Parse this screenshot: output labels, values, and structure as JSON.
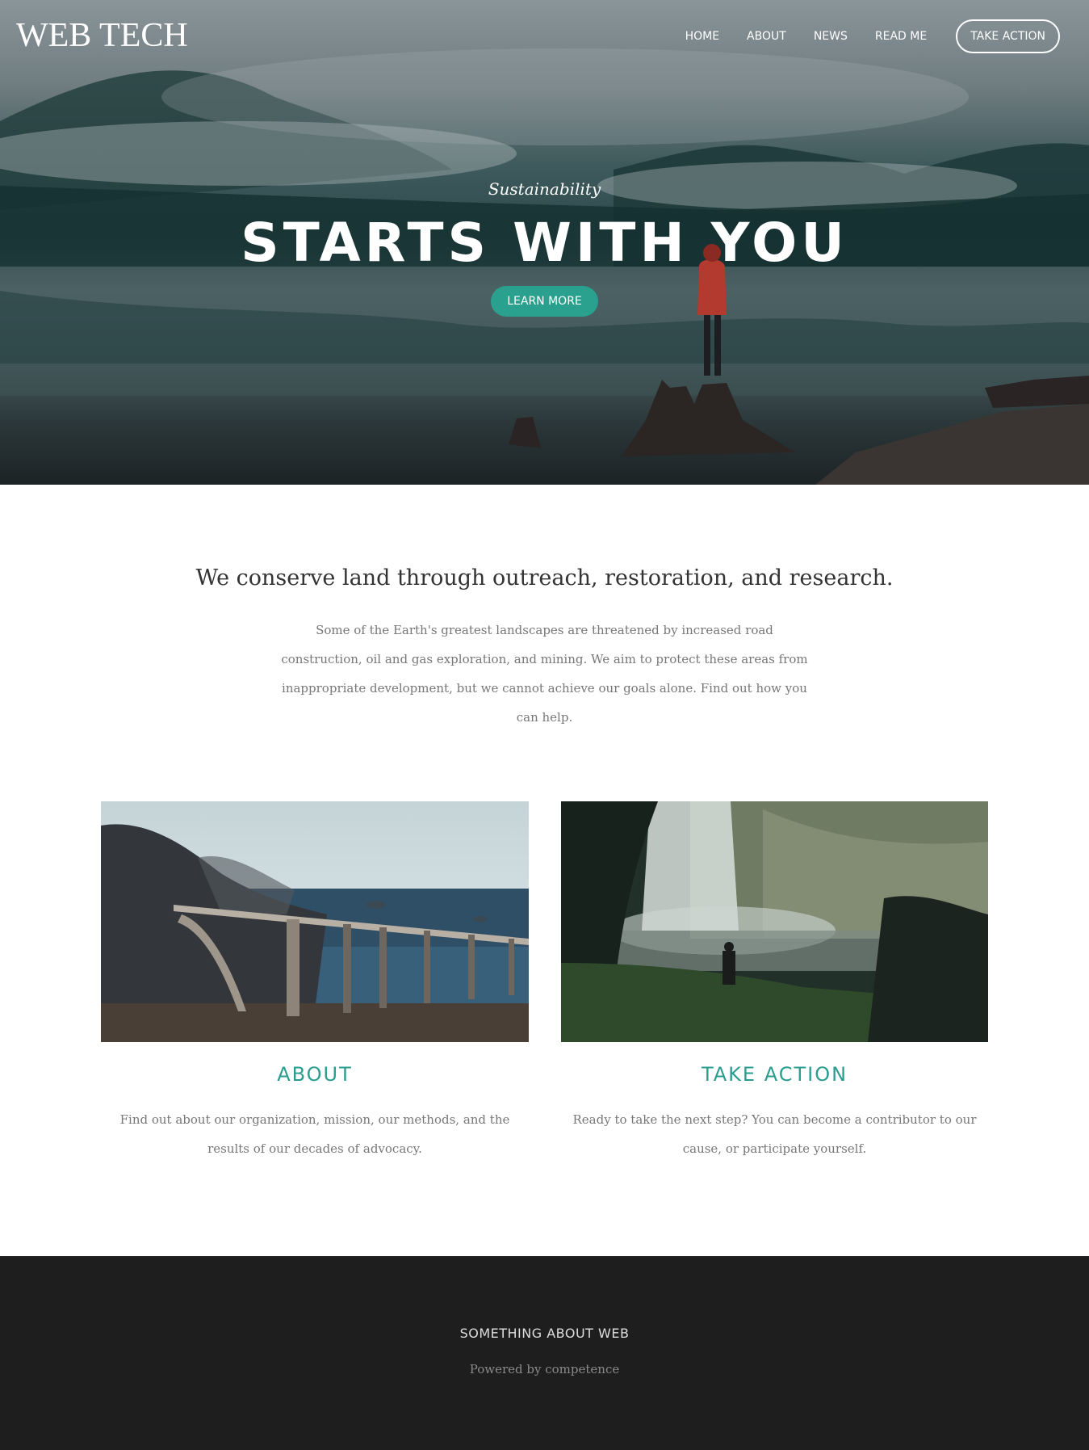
{
  "header": {
    "brand": "WEB TECH",
    "nav": [
      "HOME",
      "ABOUT",
      "NEWS",
      "READ ME"
    ],
    "cta": "TAKE ACTION"
  },
  "hero": {
    "subtitle": "Sustainability",
    "title": "STARTS WITH YOU",
    "button": "LEARN MORE"
  },
  "intro": {
    "heading": "We conserve land through outreach, restoration, and research.",
    "text": "Some of the Earth's greatest landscapes are threatened by increased road construction, oil and gas exploration, and mining. We aim to protect these areas from inappropriate development, but we cannot achieve our goals alone. Find out how you can help."
  },
  "features": [
    {
      "title": "ABOUT",
      "text": "Find out about our organization, mission, our methods, and the results of our decades of advocacy."
    },
    {
      "title": "TAKE ACTION",
      "text": "Ready to take the next step? You can become a contributor to our cause, or participate yourself."
    }
  ],
  "footer": {
    "title": "SOMETHING ABOUT WEB",
    "powered": "Powered by competence"
  },
  "colors": {
    "accent": "#2aa08e",
    "footer_bg": "#1e1e1e"
  }
}
